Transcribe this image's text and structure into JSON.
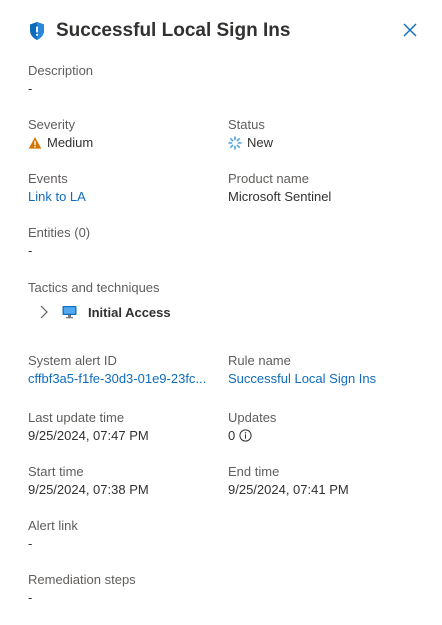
{
  "header": {
    "title": "Successful Local Sign Ins",
    "icon": "shield-icon",
    "close_icon": "close-icon"
  },
  "fields": {
    "description": {
      "label": "Description",
      "value": "-"
    },
    "severity": {
      "label": "Severity",
      "value": "Medium",
      "icon": "warning-icon",
      "color": "#d47500"
    },
    "status": {
      "label": "Status",
      "value": "New",
      "icon": "new-status-icon",
      "color": "#0f6cbd"
    },
    "events": {
      "label": "Events",
      "value": "Link to LA"
    },
    "product_name": {
      "label": "Product name",
      "value": "Microsoft Sentinel"
    },
    "entities": {
      "label": "Entities (0)",
      "value": "-"
    },
    "tactics": {
      "label": "Tactics and techniques",
      "item": "Initial Access",
      "icon": "monitor-icon"
    },
    "system_alert_id": {
      "label": "System alert ID",
      "value": "cffbf3a5-f1fe-30d3-01e9-23fc..."
    },
    "rule_name": {
      "label": "Rule name",
      "value": "Successful Local Sign Ins"
    },
    "last_update_time": {
      "label": "Last update time",
      "value": "9/25/2024, 07:47 PM"
    },
    "updates": {
      "label": "Updates",
      "value": "0",
      "icon": "info-icon"
    },
    "start_time": {
      "label": "Start time",
      "value": "9/25/2024, 07:38 PM"
    },
    "end_time": {
      "label": "End time",
      "value": "9/25/2024, 07:41 PM"
    },
    "alert_link": {
      "label": "Alert link",
      "value": "-"
    },
    "remediation_steps": {
      "label": "Remediation steps",
      "value": "-"
    }
  },
  "colors": {
    "link": "#0f6cbd",
    "label": "#605e5c",
    "text": "#323130",
    "warning": "#d47500"
  }
}
